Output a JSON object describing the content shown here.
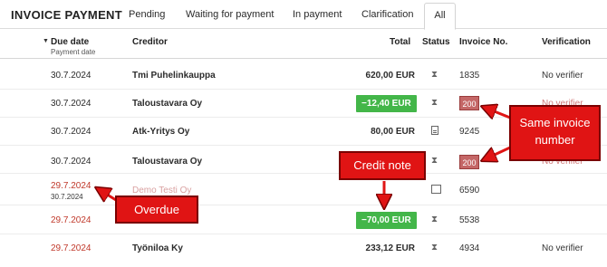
{
  "app_title": "INVOICE PAYMENT",
  "tabs": [
    "Pending",
    "Waiting for payment",
    "In payment",
    "Clarification",
    "All"
  ],
  "columns": {
    "due_date": "Due date",
    "payment_date": "Payment date",
    "creditor": "Creditor",
    "total": "Total",
    "status": "Status",
    "invoice_no": "Invoice No.",
    "verification": "Verification"
  },
  "rows": [
    {
      "date": "30.7.2024",
      "creditor": "Tmi Puhelinkauppa",
      "total": "620,00 EUR",
      "status_icon": "hourglass-icon",
      "invoice": "1835",
      "verification": "No verifier"
    },
    {
      "date": "30.7.2024",
      "creditor": "Taloustavara Oy",
      "total": "−12,40 EUR",
      "status_icon": "hourglass-icon",
      "invoice": "200",
      "verification": "No verifier"
    },
    {
      "date": "30.7.2024",
      "creditor": "Atk-Yritys Oy",
      "total": "80,00 EUR",
      "status_icon": "document-icon",
      "invoice": "9245",
      "verification": ""
    },
    {
      "date": "30.7.2024",
      "creditor": "Taloustavara Oy",
      "total": "",
      "status_icon": "hourglass-icon",
      "invoice": "200",
      "verification": "No verifier"
    },
    {
      "date": "29.7.2024",
      "date2": "30.7.2024",
      "creditor": "Demo Testi Oy",
      "total": "",
      "status_icon": "building-icon",
      "invoice": "6590",
      "verification": ""
    },
    {
      "date": "29.7.2024",
      "creditor": "",
      "total": "−70,00 EUR",
      "status_icon": "hourglass-icon",
      "invoice": "5538",
      "verification": ""
    },
    {
      "date": "29.7.2024",
      "creditor": "Työniloa Ky",
      "total": "233,12 EUR",
      "status_icon": "hourglass-icon",
      "invoice": "4934",
      "verification": "No verifier"
    }
  ],
  "annotations": {
    "same_invoice": "Same invoice number",
    "credit_note": "Credit note",
    "overdue": "Overdue"
  }
}
